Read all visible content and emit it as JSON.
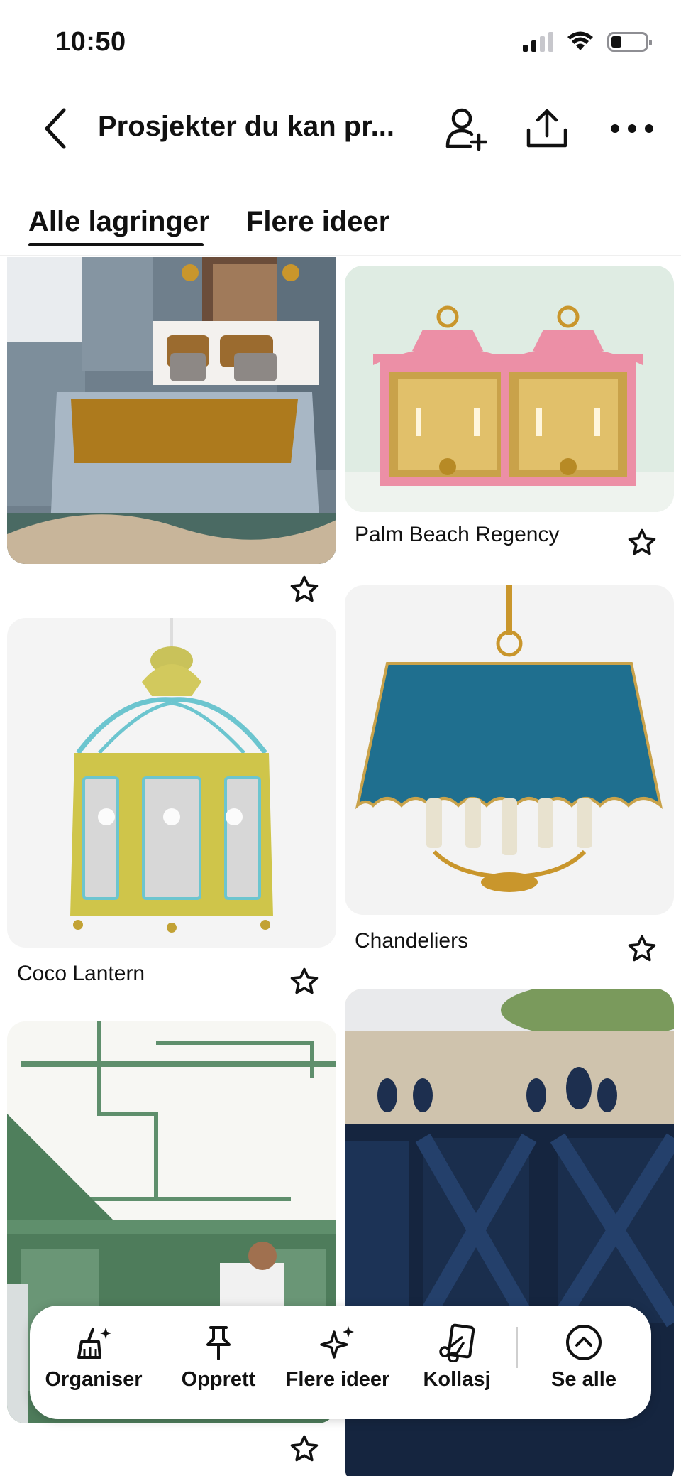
{
  "status": {
    "time": "10:50"
  },
  "header": {
    "title": "Prosjekter du kan pr...",
    "back_icon": "chevron-left-icon",
    "add_collaborator_icon": "add-person-icon",
    "share_icon": "share-icon",
    "more_icon": "more-icon"
  },
  "tabs": [
    {
      "label": "Alle lagringer",
      "active": true
    },
    {
      "label": "Flere ideer",
      "active": false
    }
  ],
  "pins": [
    {
      "label": "",
      "image": "bedroom-photo"
    },
    {
      "label": "Palm Beach Regency",
      "image": "pink-lanterns-photo"
    },
    {
      "label": "Coco Lantern",
      "image": "yellow-lantern-photo"
    },
    {
      "label": "Chandeliers",
      "image": "blue-chandelier-photo"
    },
    {
      "label": "",
      "image": "green-room-photo"
    },
    {
      "label": "",
      "image": "navy-planters-photo"
    }
  ],
  "toolbar": {
    "items": [
      {
        "label": "Organiser",
        "icon": "broom-sparkle-icon"
      },
      {
        "label": "Opprett",
        "icon": "pin-icon"
      },
      {
        "label": "Flere ideer",
        "icon": "sparkles-icon"
      },
      {
        "label": "Kollasj",
        "icon": "scissors-icon"
      },
      {
        "label": "Se alle",
        "icon": "chevron-up-circle-icon"
      }
    ]
  },
  "colors": {
    "text": "#111111",
    "background": "#ffffff"
  }
}
